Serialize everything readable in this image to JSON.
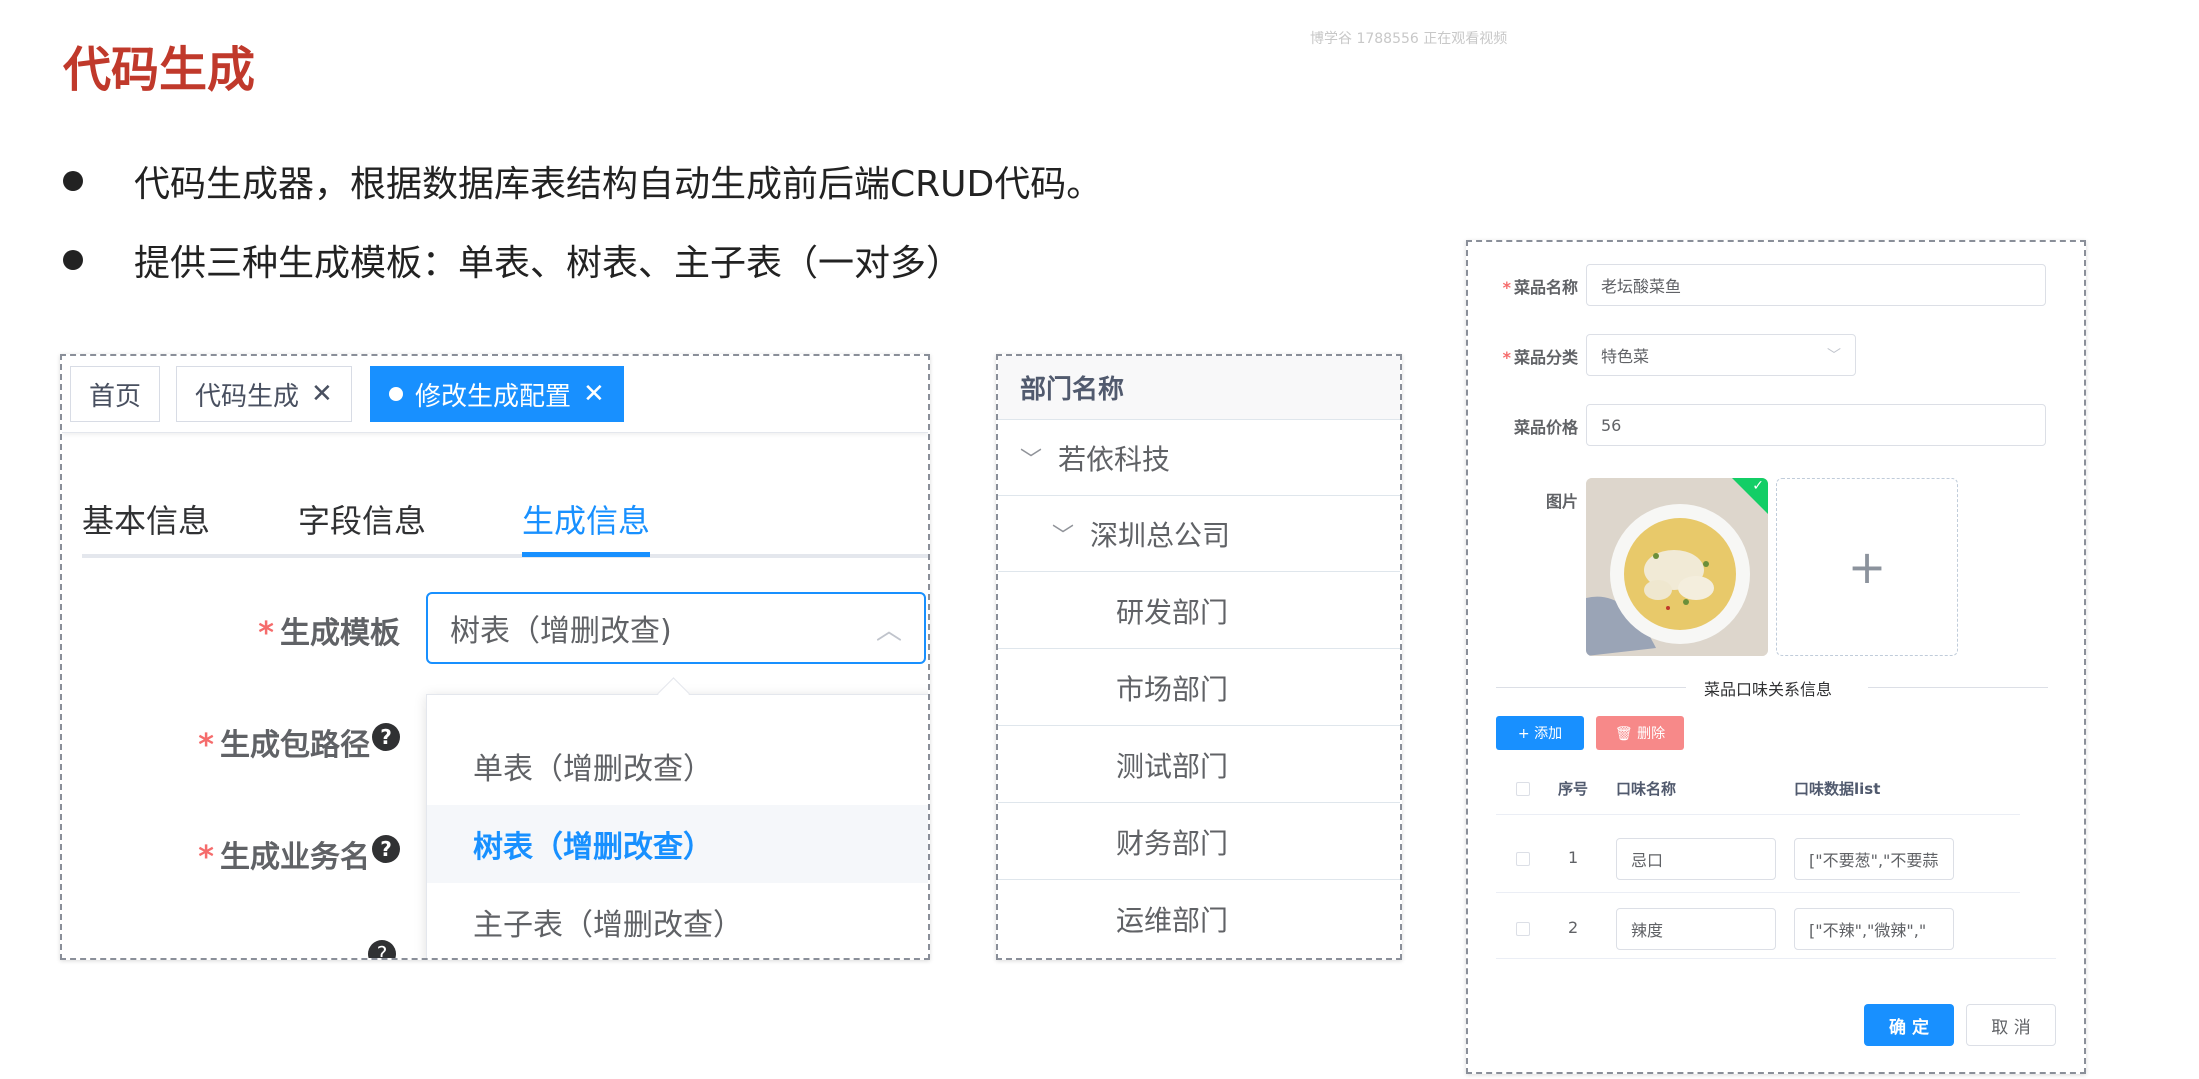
{
  "watermark": "博学谷 1788556 正在观看视频",
  "slide": {
    "title": "代码生成",
    "bullets": [
      "代码生成器，根据数据库表结构自动生成前后端CRUD代码。",
      "提供三种生成模板：单表、树表、主子表（一对多）"
    ]
  },
  "panel1": {
    "tags": [
      {
        "label": "首页"
      },
      {
        "label": "代码生成",
        "close": "✕"
      },
      {
        "label": "修改生成配置",
        "close": "✕"
      }
    ],
    "tabs": [
      "基本信息",
      "字段信息",
      "生成信息"
    ],
    "required_mark": "*",
    "help_mark": "?",
    "form_labels": [
      "生成模板",
      "生成包路径",
      "生成业务名"
    ],
    "select_value": "树表（增删改查)",
    "select_chevron": "︿",
    "options": [
      "单表（增删改查）",
      "树表（增删改查）",
      "主子表（增删改查）"
    ]
  },
  "panel2": {
    "header": "部门名称",
    "expand_icon": "﹀",
    "rows": [
      {
        "label": "若依科技"
      },
      {
        "label": "深圳总公司"
      },
      {
        "label": "研发部门"
      },
      {
        "label": "市场部门"
      },
      {
        "label": "测试部门"
      },
      {
        "label": "财务部门"
      },
      {
        "label": "运维部门"
      }
    ]
  },
  "panel3": {
    "required_mark": "*",
    "labels": {
      "name": "菜品名称",
      "category": "菜品分类",
      "price": "菜品价格",
      "image": "图片"
    },
    "values": {
      "name": "老坛酸菜鱼",
      "category": "特色菜",
      "price": "56"
    },
    "select_chevron": "﹀",
    "upload_plus": "+",
    "check_mark": "✓",
    "divider_title": "菜品口味关系信息",
    "add_button": "+ 添加",
    "delete_button": "🗑 删除",
    "columns": [
      "序号",
      "口味名称",
      "口味数据list"
    ],
    "rows": [
      {
        "index": "1",
        "name": "忌口",
        "list": "[\"不要葱\",\"不要蒜"
      },
      {
        "index": "2",
        "name": "辣度",
        "list": "[\"不辣\",\"微辣\",\""
      }
    ],
    "ok_button": "确 定",
    "cancel_button": "取 消"
  }
}
